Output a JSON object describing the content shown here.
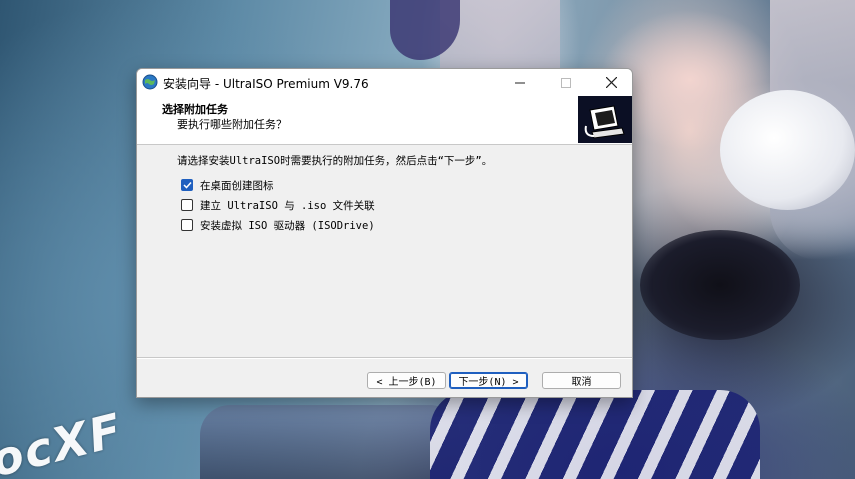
{
  "window": {
    "title": "安装向导 - UltraISO Premium V9.76",
    "icon": "globe-disc-icon",
    "controls": [
      "minimize-icon",
      "maximize-icon",
      "close-icon"
    ]
  },
  "header": {
    "title": "选择附加任务",
    "subtitle": "要执行哪些附加任务？",
    "image": "installer-computer-icon"
  },
  "body": {
    "instruction": "请选择安装UltraISO时需要执行的附加任务，然后点击“下一步”。",
    "tasks": [
      {
        "label": "在桌面创建图标",
        "checked": true
      },
      {
        "label": "建立 UltraISO 与 .iso 文件关联",
        "checked": false
      },
      {
        "label": "安装虚拟 ISO 驱动器 (ISODrive)",
        "checked": false
      }
    ]
  },
  "buttons": {
    "back": "< 上一步(B)",
    "next": "下一步(N) >",
    "cancel": "取消"
  },
  "wallpaper": {
    "watermark": "ocXF"
  },
  "colors": {
    "accent": "#1f5fbf",
    "dialog_bg": "#f0f0f0",
    "header_bg": "#ffffff"
  }
}
